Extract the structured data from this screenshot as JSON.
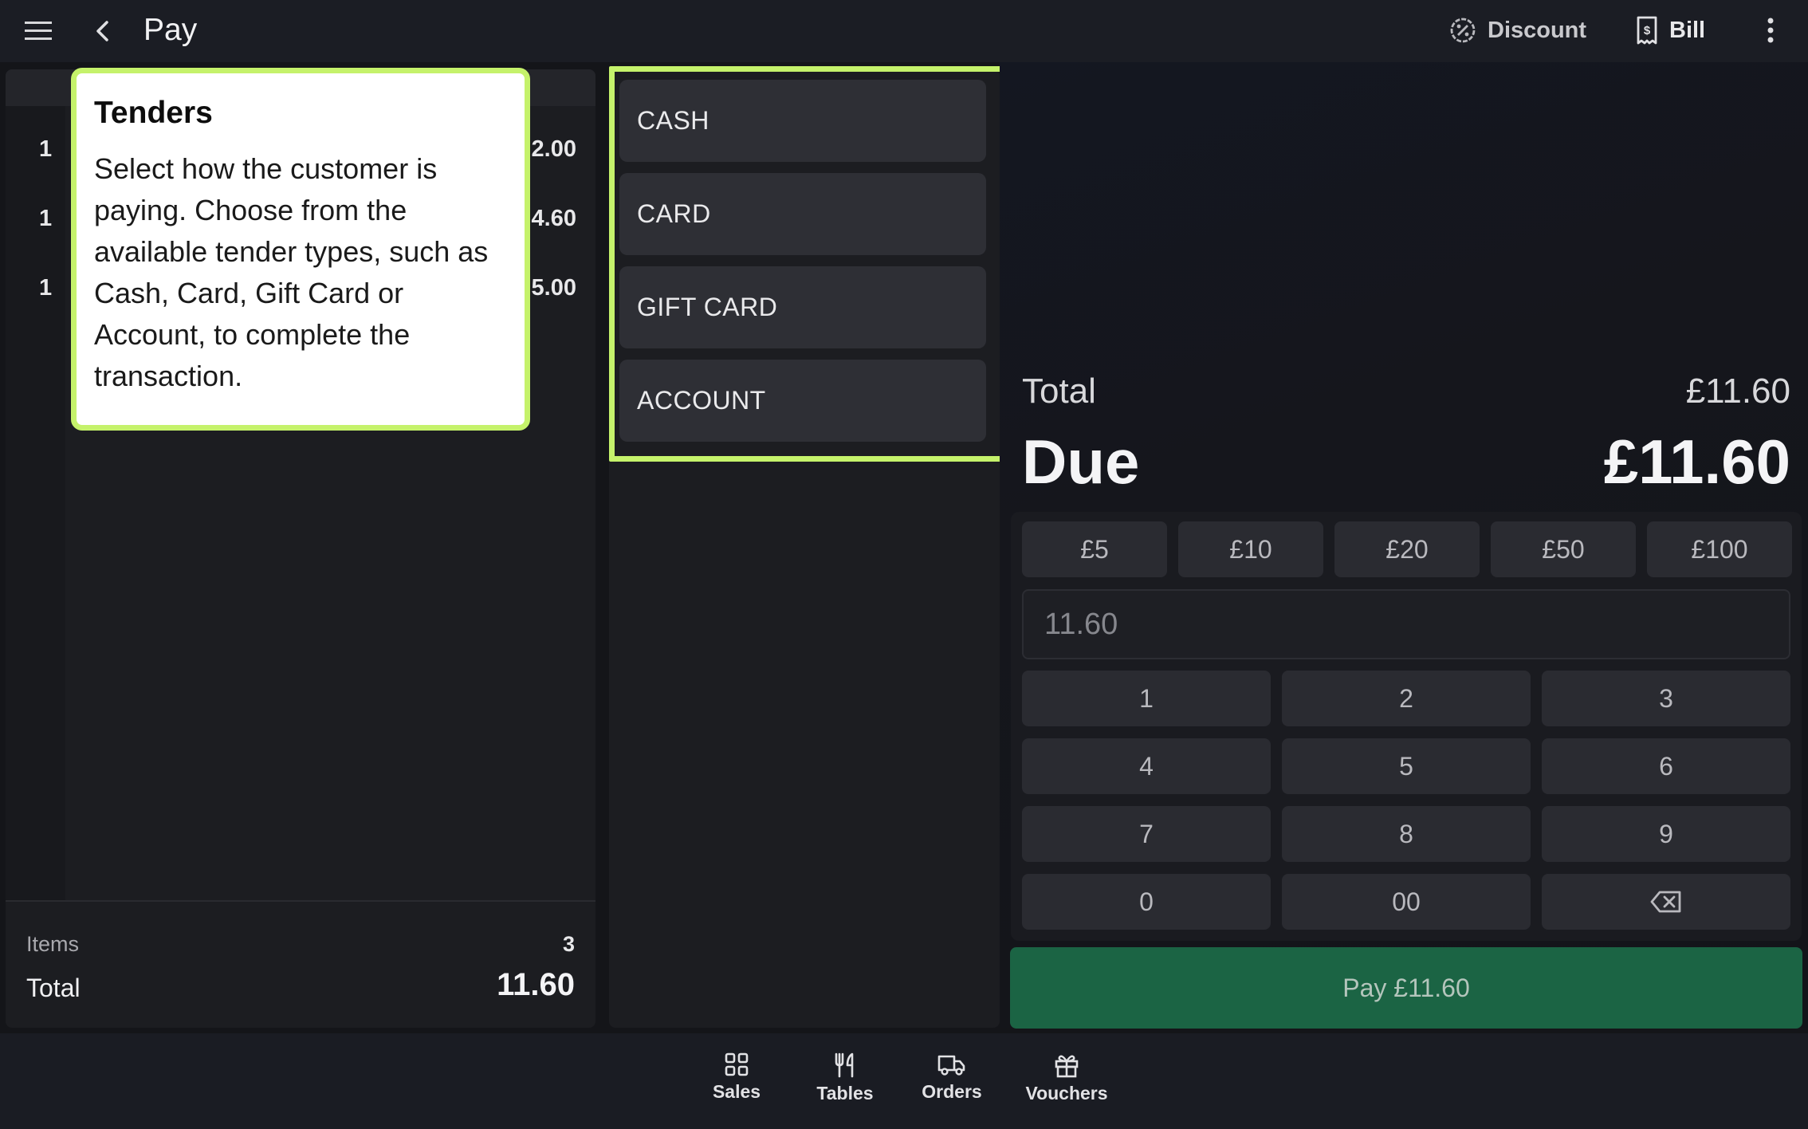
{
  "header": {
    "title": "Pay",
    "discount_label": "Discount",
    "bill_label": "Bill"
  },
  "order": {
    "lines": [
      {
        "qty": "1",
        "price": "2.00"
      },
      {
        "qty": "1",
        "price": "4.60"
      },
      {
        "qty": "1",
        "price": "5.00"
      }
    ],
    "items_label": "Items",
    "items_count": "3",
    "total_label": "Total",
    "total_value": "11.60"
  },
  "tooltip": {
    "title": "Tenders",
    "body": "Select how the customer is paying. Choose from the available tender types, such as Cash, Card, Gift Card or Account, to complete the transaction."
  },
  "tenders": [
    "CASH",
    "CARD",
    "GIFT CARD",
    "ACCOUNT"
  ],
  "summary": {
    "total_label": "Total",
    "total_value": "£11.60",
    "due_label": "Due",
    "due_value": "£11.60"
  },
  "quick_amounts": [
    "£5",
    "£10",
    "£20",
    "£50",
    "£100"
  ],
  "amount_input": {
    "value": "11.60"
  },
  "keypad": [
    "1",
    "2",
    "3",
    "4",
    "5",
    "6",
    "7",
    "8",
    "9",
    "0",
    "00"
  ],
  "pay_button": "Pay £11.60",
  "bottom_nav": [
    {
      "label": "Sales",
      "icon": "grid-icon"
    },
    {
      "label": "Tables",
      "icon": "cutlery-icon"
    },
    {
      "label": "Orders",
      "icon": "delivery-truck-icon"
    },
    {
      "label": "Vouchers",
      "icon": "gift-icon"
    }
  ],
  "colors": {
    "highlight": "#c5f26b",
    "pay_button": "#1b6444",
    "background": "#141519"
  }
}
